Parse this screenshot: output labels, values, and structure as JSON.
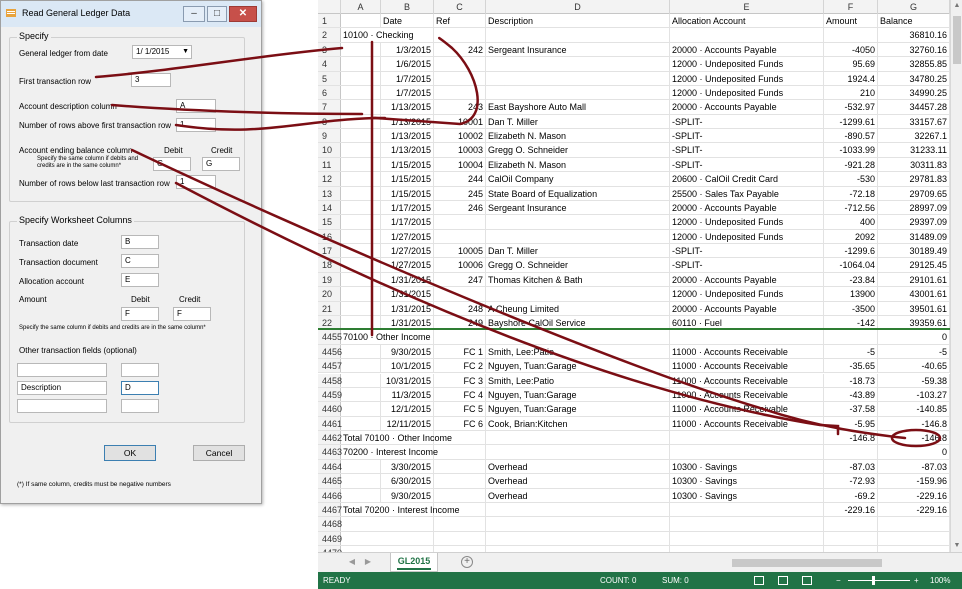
{
  "excel": {
    "columns": [
      "A",
      "B",
      "C",
      "D",
      "E",
      "F",
      "G"
    ],
    "header_row": {
      "num": "1",
      "cells": [
        "",
        "Date",
        "Ref",
        "Description",
        "Allocation Account",
        "Amount",
        "Balance"
      ]
    },
    "rows": [
      {
        "num": "2",
        "cells": [
          "10100 · Checking",
          "",
          "",
          "",
          "",
          "",
          "36810.16"
        ]
      },
      {
        "num": "3",
        "cells": [
          "",
          "1/3/2015",
          "242",
          "Sergeant Insurance",
          "20000 · Accounts Payable",
          "-4050",
          "32760.16"
        ]
      },
      {
        "num": "4",
        "cells": [
          "",
          "1/6/2015",
          "",
          "",
          "12000 · Undeposited Funds",
          "95.69",
          "32855.85"
        ]
      },
      {
        "num": "5",
        "cells": [
          "",
          "1/7/2015",
          "",
          "",
          "12000 · Undeposited Funds",
          "1924.4",
          "34780.25"
        ]
      },
      {
        "num": "6",
        "cells": [
          "",
          "1/7/2015",
          "",
          "",
          "12000 · Undeposited Funds",
          "210",
          "34990.25"
        ]
      },
      {
        "num": "7",
        "cells": [
          "",
          "1/13/2015",
          "243",
          "East Bayshore Auto Mall",
          "20000 · Accounts Payable",
          "-532.97",
          "34457.28"
        ]
      },
      {
        "num": "8",
        "cells": [
          "",
          "1/13/2015",
          "10001",
          "Dan T. Miller",
          "-SPLIT-",
          "-1299.61",
          "33157.67"
        ]
      },
      {
        "num": "9",
        "cells": [
          "",
          "1/13/2015",
          "10002",
          "Elizabeth N. Mason",
          "-SPLIT-",
          "-890.57",
          "32267.1"
        ]
      },
      {
        "num": "10",
        "cells": [
          "",
          "1/13/2015",
          "10003",
          "Gregg O. Schneider",
          "-SPLIT-",
          "-1033.99",
          "31233.11"
        ]
      },
      {
        "num": "11",
        "cells": [
          "",
          "1/15/2015",
          "10004",
          "Elizabeth N. Mason",
          "-SPLIT-",
          "-921.28",
          "30311.83"
        ]
      },
      {
        "num": "12",
        "cells": [
          "",
          "1/15/2015",
          "244",
          "CalOil Company",
          "20600 · CalOil Credit Card",
          "-530",
          "29781.83"
        ]
      },
      {
        "num": "13",
        "cells": [
          "",
          "1/15/2015",
          "245",
          "State Board of Equalization",
          "25500 · Sales Tax Payable",
          "-72.18",
          "29709.65"
        ]
      },
      {
        "num": "14",
        "cells": [
          "",
          "1/17/2015",
          "246",
          "Sergeant Insurance",
          "20000 · Accounts Payable",
          "-712.56",
          "28997.09"
        ]
      },
      {
        "num": "15",
        "cells": [
          "",
          "1/17/2015",
          "",
          "",
          "12000 · Undeposited Funds",
          "400",
          "29397.09"
        ]
      },
      {
        "num": "16",
        "cells": [
          "",
          "1/27/2015",
          "",
          "",
          "12000 · Undeposited Funds",
          "2092",
          "31489.09"
        ]
      },
      {
        "num": "17",
        "cells": [
          "",
          "1/27/2015",
          "10005",
          "Dan T. Miller",
          "-SPLIT-",
          "-1299.6",
          "30189.49"
        ]
      },
      {
        "num": "18",
        "cells": [
          "",
          "1/27/2015",
          "10006",
          "Gregg O. Schneider",
          "-SPLIT-",
          "-1064.04",
          "29125.45"
        ]
      },
      {
        "num": "19",
        "cells": [
          "",
          "1/31/2015",
          "247",
          "Thomas Kitchen & Bath",
          "20000 · Accounts Payable",
          "-23.84",
          "29101.61"
        ]
      },
      {
        "num": "20",
        "cells": [
          "",
          "1/31/2015",
          "",
          "",
          "12000 · Undeposited Funds",
          "13900",
          "43001.61"
        ]
      },
      {
        "num": "21",
        "cells": [
          "",
          "1/31/2015",
          "248",
          "A Cheung Limited",
          "20000 · Accounts Payable",
          "-3500",
          "39501.61"
        ]
      },
      {
        "num": "22",
        "cells": [
          "",
          "1/31/2015",
          "249",
          "Bayshore CalOil Service",
          "60110 · Fuel",
          "-142",
          "39359.61"
        ]
      },
      {
        "num": "4455",
        "cells": [
          "70100 · Other Income",
          "",
          "",
          "",
          "",
          "",
          "0"
        ]
      },
      {
        "num": "4456",
        "cells": [
          "",
          "9/30/2015",
          "FC 1",
          "Smith, Lee:Patio",
          "11000 · Accounts Receivable",
          "-5",
          "-5"
        ]
      },
      {
        "num": "4457",
        "cells": [
          "",
          "10/1/2015",
          "FC 2",
          "Nguyen, Tuan:Garage",
          "11000 · Accounts Receivable",
          "-35.65",
          "-40.65"
        ]
      },
      {
        "num": "4458",
        "cells": [
          "",
          "10/31/2015",
          "FC 3",
          "Smith, Lee:Patio",
          "11000 · Accounts Receivable",
          "-18.73",
          "-59.38"
        ]
      },
      {
        "num": "4459",
        "cells": [
          "",
          "11/3/2015",
          "FC 4",
          "Nguyen, Tuan:Garage",
          "11000 · Accounts Receivable",
          "-43.89",
          "-103.27"
        ]
      },
      {
        "num": "4460",
        "cells": [
          "",
          "12/1/2015",
          "FC 5",
          "Nguyen, Tuan:Garage",
          "11000 · Accounts Receivable",
          "-37.58",
          "-140.85"
        ]
      },
      {
        "num": "4461",
        "cells": [
          "",
          "12/11/2015",
          "FC 6",
          "Cook, Brian:Kitchen",
          "11000 · Accounts Receivable",
          "-5.95",
          "-146.8"
        ]
      },
      {
        "num": "4462",
        "cells": [
          "Total 70100 · Other Income",
          "",
          "",
          "",
          "",
          "-146.8",
          "-146.8"
        ]
      },
      {
        "num": "4463",
        "cells": [
          "70200 · Interest Income",
          "",
          "",
          "",
          "",
          "",
          "0"
        ]
      },
      {
        "num": "4464",
        "cells": [
          "",
          "3/30/2015",
          "",
          "Overhead",
          "10300 · Savings",
          "-87.03",
          "-87.03"
        ]
      },
      {
        "num": "4465",
        "cells": [
          "",
          "6/30/2015",
          "",
          "Overhead",
          "10300 · Savings",
          "-72.93",
          "-159.96"
        ]
      },
      {
        "num": "4466",
        "cells": [
          "",
          "9/30/2015",
          "",
          "Overhead",
          "10300 · Savings",
          "-69.2",
          "-229.16"
        ]
      },
      {
        "num": "4467",
        "cells": [
          "Total 70200 · Interest Income",
          "",
          "",
          "",
          "",
          "-229.16",
          "-229.16"
        ]
      },
      {
        "num": "4468",
        "cells": [
          "",
          "",
          "",
          "",
          "",
          "",
          ""
        ]
      },
      {
        "num": "4469",
        "cells": [
          "",
          "",
          "",
          "",
          "",
          "",
          ""
        ]
      },
      {
        "num": "4470",
        "cells": [
          "",
          "",
          "",
          "",
          "",
          "",
          ""
        ]
      }
    ],
    "sheet_tab": "GL2015",
    "status": {
      "ready": "READY",
      "count": "COUNT: 0",
      "sum": "SUM: 0",
      "zoom": "100%"
    }
  },
  "dialog": {
    "title": "Read General Ledger Data",
    "specify_group": "Specify",
    "gl_from_date_label": "General ledger from date",
    "gl_from_date_value": "1/ 1/2015",
    "first_row_label": "First transaction row",
    "first_row_value": "3",
    "acct_desc_col_label": "Account description column",
    "acct_desc_col_value": "A",
    "rows_above_label": "Number of rows above first transaction row",
    "rows_above_value": "1",
    "ending_balance_label": "Account ending balance column",
    "ending_balance_note": "Specify the same column if debits and credits are in the same column*",
    "debit_label": "Debit",
    "credit_label": "Credit",
    "ending_debit_value": "G",
    "ending_credit_value": "G",
    "rows_below_label": "Number of rows below last transaction row",
    "rows_below_value": "1",
    "worksheet_group": "Specify Worksheet Columns",
    "txn_date_label": "Transaction date",
    "txn_date_value": "B",
    "txn_doc_label": "Transaction document",
    "txn_doc_value": "C",
    "alloc_acct_label": "Allocation account",
    "alloc_acct_value": "E",
    "amount_label": "Amount",
    "amount_debit_label": "Debit",
    "amount_credit_label": "Credit",
    "amount_debit_value": "F",
    "amount_credit_value": "F",
    "same_col_note": "Specify the same column if debits and credits are in the same column*",
    "other_fields_label": "Other transaction fields (optional)",
    "other_fields": [
      {
        "name": "",
        "col": ""
      },
      {
        "name": "Description",
        "col": "D"
      },
      {
        "name": "",
        "col": ""
      }
    ],
    "ok_label": "OK",
    "cancel_label": "Cancel",
    "footnote": "(*) If same column, credits must be negative numbers"
  },
  "annotation_color": "#7b0e14"
}
